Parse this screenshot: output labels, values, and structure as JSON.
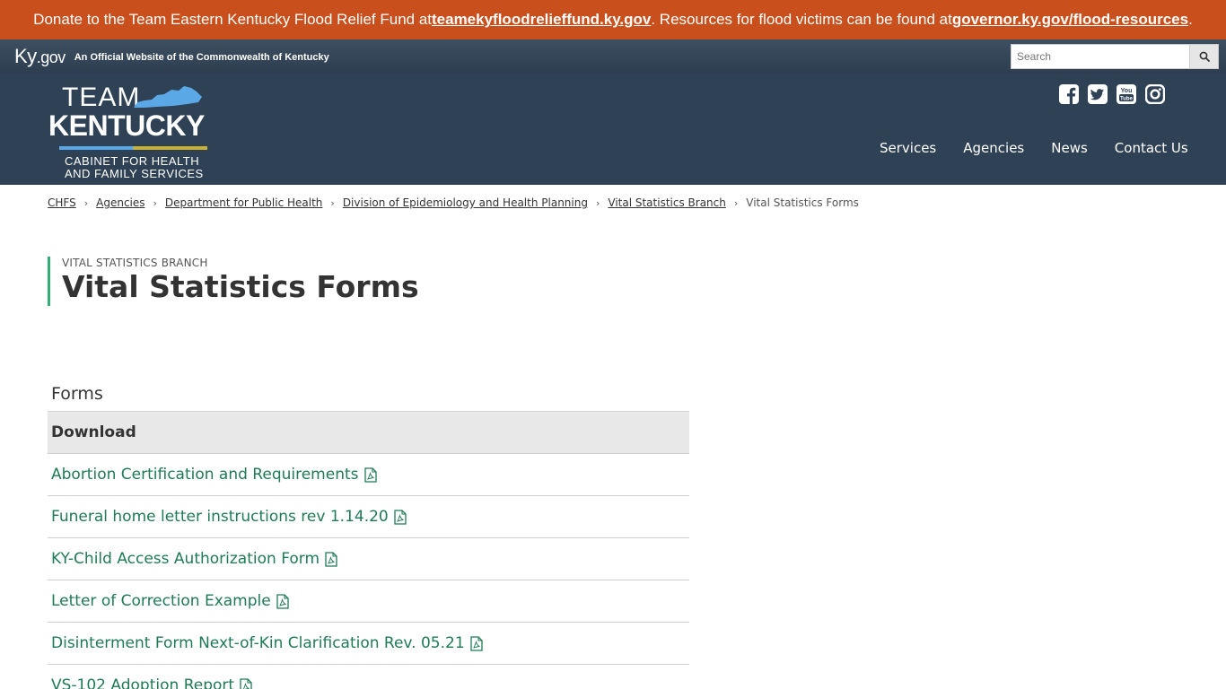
{
  "alert": {
    "text1": "Donate to the Team Eastern Kentucky Flood Relief Fund at ",
    "link1": "teamekyfloodrelieffund.ky.gov",
    "text2": ". Resources for flood victims can be found at ",
    "link2": "governor.ky.gov/flood-resources",
    "text3": "."
  },
  "kygov": {
    "logo_ky": "Ky",
    "logo_gov": ".gov",
    "tagline": "An Official Website of the Commonwealth of Kentucky",
    "search_placeholder": "Search"
  },
  "logo": {
    "team": "TEAM",
    "kentucky": "KENTUCKY",
    "sub1": "CABINET FOR HEALTH",
    "sub2": "AND FAMILY SERVICES"
  },
  "social": [
    "facebook-icon",
    "twitter-icon",
    "youtube-icon",
    "instagram-icon"
  ],
  "nav": [
    "Services",
    "Agencies",
    "News",
    "Contact Us"
  ],
  "breadcrumb": {
    "links": [
      "CHFS",
      "Agencies",
      "Department for Public Health",
      "Division of Epidemiology and Health Planning",
      "Vital Statistics Branch"
    ],
    "current": "Vital Statistics Forms"
  },
  "page": {
    "eyebrow": "Vital Statistics Branch",
    "title": "Vital Statistics Forms"
  },
  "forms": {
    "caption": "Forms",
    "header": "Download",
    "rows": [
      "Abortion Certification and Requirements",
      "Funeral home letter instructions rev 1.14.20",
      "KY-Child Access Authorization Form",
      "Letter of Correction Example",
      "Disinterment Form Next-of-Kin Clarification Rev. 05.21",
      "VS-102 Adoption Report"
    ]
  },
  "colors": {
    "alert_bg": "#c9501c",
    "header_bg": "#2f4155",
    "link_green": "#1f7a55",
    "accent_green": "#30b078"
  }
}
